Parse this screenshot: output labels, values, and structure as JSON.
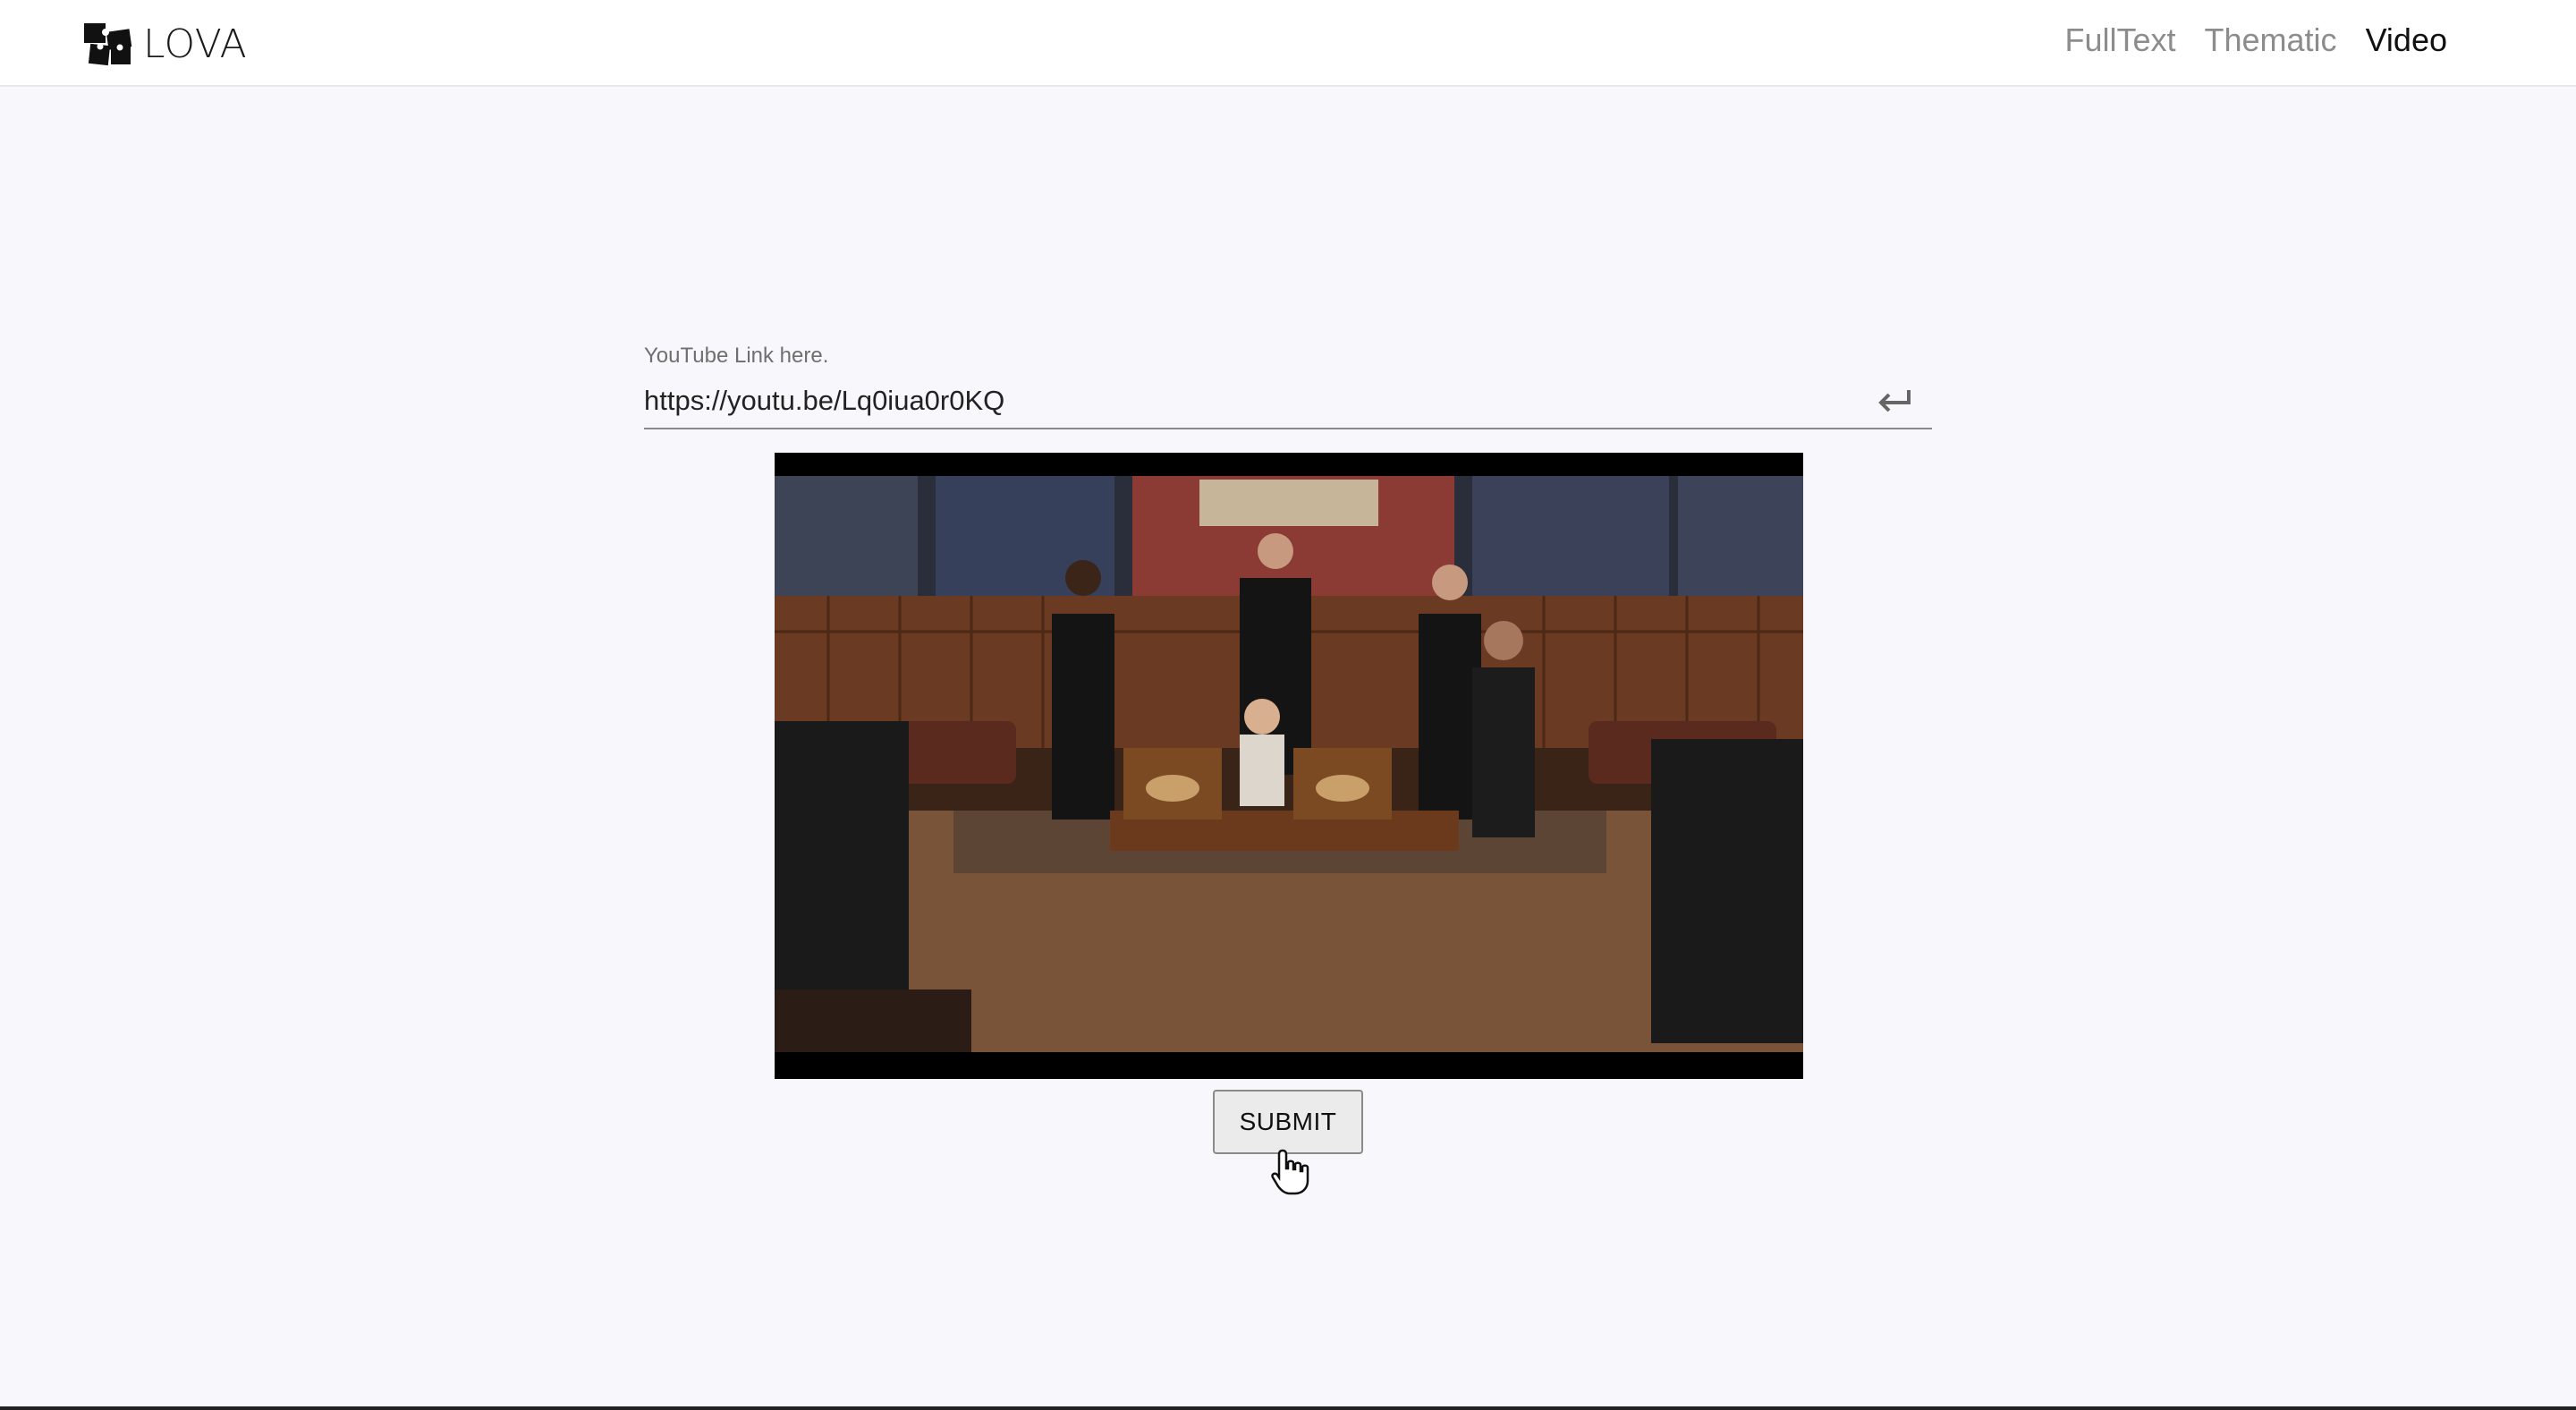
{
  "app": {
    "brand": "LOVA"
  },
  "nav": {
    "items": [
      {
        "label": "FullText",
        "active": false
      },
      {
        "label": "Thematic",
        "active": false
      },
      {
        "label": "Video",
        "active": true
      }
    ]
  },
  "url_field": {
    "label": "YouTube Link here.",
    "value": "https://youtu.be/Lq0iua0r0KQ",
    "submit_icon": "enter-return-icon"
  },
  "video": {
    "scene": "debate-chamber-frame"
  },
  "form": {
    "submit_label": "SUBMIT"
  },
  "colors": {
    "background": "#f8f8fc",
    "header": "#ffffff",
    "nav_inactive": "#8c8c8c",
    "nav_active": "#111111",
    "button_bg": "#ebebeb"
  }
}
